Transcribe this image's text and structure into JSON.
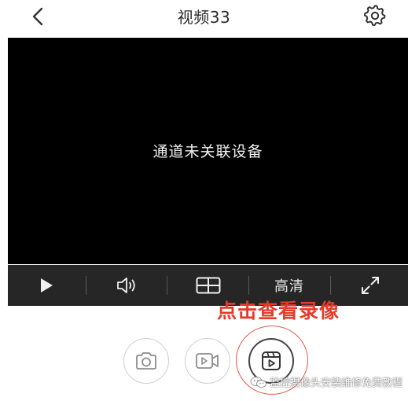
{
  "header": {
    "title": "视频33",
    "back_icon": "chevron-left-icon",
    "settings_icon": "gear-icon"
  },
  "video": {
    "message": "通道未关联设备"
  },
  "controls": {
    "play_icon": "play-icon",
    "volume_icon": "speaker-icon",
    "layout_icon": "split-screen-icon",
    "quality_label": "高清",
    "fullscreen_icon": "expand-icon"
  },
  "annotation": {
    "text": "点击查看录像",
    "color": "#e53a2a"
  },
  "actions": {
    "snapshot_icon": "camera-icon",
    "record_icon": "video-record-icon",
    "playback_icon": "playback-icon"
  },
  "watermark": {
    "text": "监控摄像头安装维修免费教程"
  }
}
